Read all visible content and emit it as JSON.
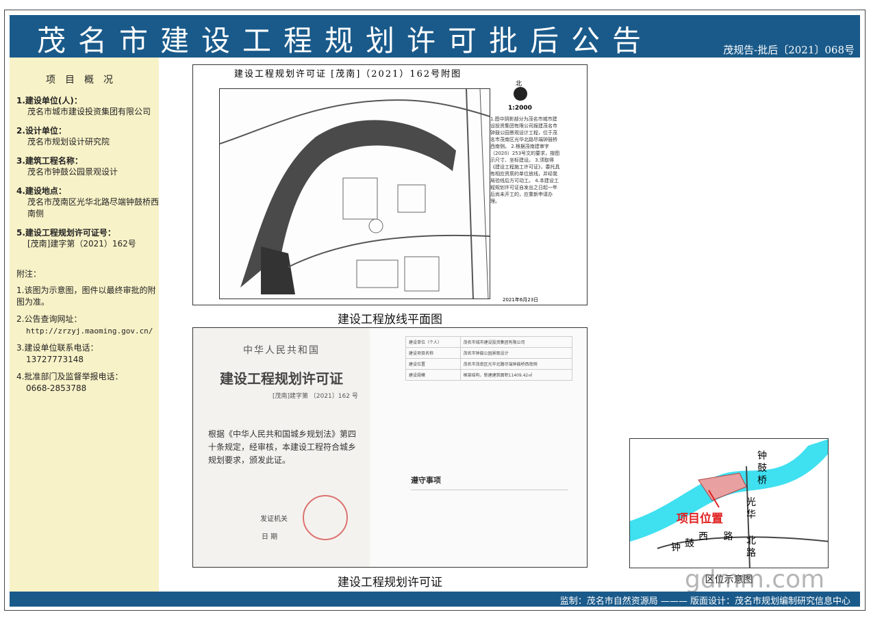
{
  "header": {
    "title": "茂名市建设工程规划许可批后公告",
    "notice_no": "茂规告-批后〔2021〕068号"
  },
  "sidebar": {
    "title": "项目概况",
    "items": [
      {
        "label": "1.建设单位(人)：",
        "value": "茂名市城市建设投资集团有限公司"
      },
      {
        "label": "2.设计单位：",
        "value": "茂名市规划设计研究院"
      },
      {
        "label": "3.建筑工程名称：",
        "value": "茂名市钟鼓公园景观设计"
      },
      {
        "label": "4.建设地点：",
        "value": "茂名市茂南区光华北路尽端钟鼓桥西南侧"
      },
      {
        "label": "5.建设工程规划许可证号：",
        "value": "[茂南]建字第（2021）162号"
      }
    ],
    "notes_title": "附注：",
    "notes": [
      {
        "label": "1.该图为示意图，图件以最终审批的附图为准。",
        "value": ""
      },
      {
        "label": "2.公告查询网址：",
        "value": "http://zrzyj.maoming.gov.cn/"
      },
      {
        "label": "3.建设单位联系电话：",
        "value": "13727773148"
      },
      {
        "label": "4.批准部门及监督举报电话：",
        "value": "0668-2853788"
      }
    ]
  },
  "plan": {
    "title": "建设工程规划许可证 [茂南]（2021）162号附图",
    "scale": "1:2000",
    "north": "北",
    "notes": "1.图中阴影部分为茂名市城市建设投资集团有限公司报建茂名市钟鼓公园景观设计工程，位于茂名市茂南区光华北路尽端钟鼓桥西南侧。 2.根据茂南建审字（2020）253号文的要求，按图示尺寸、坐标建设。 3.须取得《建设工程施工许可证》，委托具有相应资质的单位放线，并经我局验线后方可动工。 4.本建设工程规划许可证自发出之日起一年后尚未开工的，应重新申请办理。",
    "date": "2021年6月23日",
    "caption": "建设工程放线平面图"
  },
  "certificate": {
    "country": "中华人民共和国",
    "title": "建设工程规划许可证",
    "number": "[茂南]建字第 〔2021〕162 号",
    "body": "根据《中华人民共和国城乡规划法》第四十条规定，经审核，本建设工程符合城乡规划要求，颁发此证。",
    "issuer_label": "发证机关",
    "date_label": "日 期",
    "table": [
      {
        "k": "建设单位（个人）",
        "v": "茂名市城市建设投资集团有限公司"
      },
      {
        "k": "建设项目名称",
        "v": "茂名市钟鼓公园景观设计"
      },
      {
        "k": "建设位置",
        "v": "茂名市茂南区光华北路尽端钟鼓桥西南侧"
      },
      {
        "k": "建设规模",
        "v": "框架结构，新建建筑面积11409.42㎡"
      }
    ],
    "notice_title": "遵守事项",
    "caption": "建设工程规划许可证"
  },
  "location_map": {
    "label": "项目位置",
    "roads": [
      "钟",
      "鼓",
      "桥",
      "光",
      "华",
      "西",
      "路",
      "鼓",
      "北",
      "路",
      "钟"
    ],
    "caption": "区位示意图"
  },
  "footer": {
    "text": "监制：茂名市自然资源局 ——— 版面设计：茂名市规划编制研究信息中心"
  },
  "watermark": "gdmm.com",
  "colors": {
    "header": "#1a5a8a",
    "sidebar": "#f8f2c8",
    "river": "#3fe0f0",
    "site": "#e8a0a0",
    "label_red": "#e02020"
  }
}
